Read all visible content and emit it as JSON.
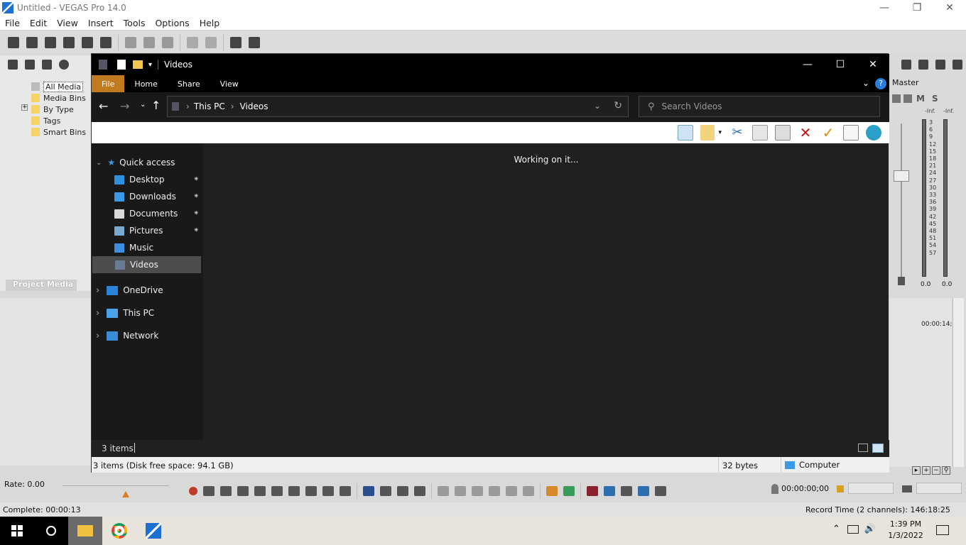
{
  "vegas": {
    "title": "Untitled - VEGAS Pro 14.0",
    "menu": [
      "File",
      "Edit",
      "View",
      "Insert",
      "Tools",
      "Options",
      "Help"
    ],
    "media_tree": [
      "All Media",
      "Media Bins",
      "By Type",
      "Tags",
      "Smart Bins"
    ],
    "project_media_tab": "Project Media",
    "master_label": "Master",
    "master_m": "M",
    "master_s": "S",
    "meter_top": [
      "-Inf.",
      "-Inf."
    ],
    "meter_scale": [
      "3",
      "6",
      "9",
      "12",
      "15",
      "18",
      "21",
      "24",
      "27",
      "30",
      "33",
      "36",
      "39",
      "42",
      "45",
      "48",
      "51",
      "54",
      "57"
    ],
    "meter_bottom": [
      "0.0",
      "0.0"
    ],
    "timecode_right": "00:00:14;(",
    "rate_label": "Rate: 0.00",
    "timecode": "00:00:00;00",
    "complete": "Complete: 00:00:13",
    "record_time": "Record Time (2 channels): 146:18:25"
  },
  "explorer": {
    "title": "Videos",
    "ribbon_tabs": [
      "File",
      "Home",
      "Share",
      "View"
    ],
    "breadcrumb": [
      "This PC",
      "Videos"
    ],
    "search_placeholder": "Search Videos",
    "nav": {
      "quick_access": "Quick access",
      "items": [
        {
          "label": "Desktop",
          "pinned": true,
          "color": "#2f8fe0"
        },
        {
          "label": "Downloads",
          "pinned": true,
          "color": "#3a9ae8"
        },
        {
          "label": "Documents",
          "pinned": true,
          "color": "#d8d8d8"
        },
        {
          "label": "Pictures",
          "pinned": true,
          "color": "#7aa9d0"
        },
        {
          "label": "Music",
          "pinned": false,
          "color": "#3b8ee0"
        },
        {
          "label": "Videos",
          "pinned": false,
          "color": "#6a7b9a"
        }
      ],
      "roots": [
        {
          "label": "OneDrive",
          "color": "#2b84d8"
        },
        {
          "label": "This PC",
          "color": "#4aa3e8"
        },
        {
          "label": "Network",
          "color": "#3a8cd8"
        }
      ]
    },
    "working_text": "Working on it...",
    "item_count": "3 items",
    "status_left": "3 items (Disk free space: 94.1 GB)",
    "status_size": "32 bytes",
    "status_location": "Computer"
  },
  "taskbar": {
    "time": "1:39 PM",
    "date": "1/3/2022"
  }
}
